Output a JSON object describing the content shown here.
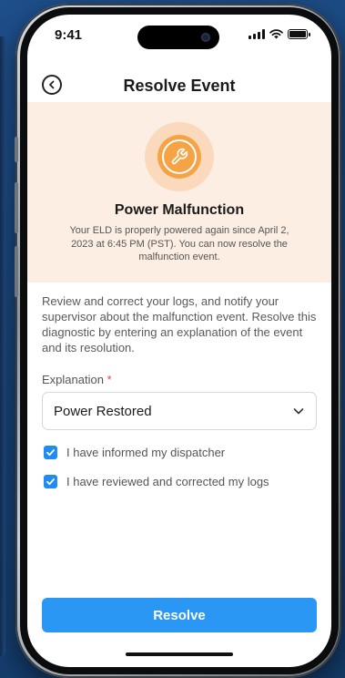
{
  "status_bar": {
    "time": "9:41"
  },
  "header": {
    "title": "Resolve Event"
  },
  "banner": {
    "title": "Power Malfunction",
    "message": "Your ELD is properly powered again since April 2, 2023 at 6:45 PM (PST). You can now resolve the malfunction event.",
    "icon": "wrench-icon",
    "accent_color": "#f6a346",
    "background_color": "#fdeee3"
  },
  "description": "Review and correct your logs, and notify your supervisor about the malfunction event. Resolve this diagnostic by entering an explanation of the event and its resolution.",
  "explanation": {
    "label": "Explanation",
    "required_mark": "*",
    "selected_value": "Power Restored"
  },
  "checkboxes": [
    {
      "label": "I have informed my dispatcher",
      "checked": true
    },
    {
      "label": "I have reviewed and corrected my logs",
      "checked": true
    }
  ],
  "actions": {
    "resolve_label": "Resolve",
    "primary_color": "#2a97f5"
  }
}
